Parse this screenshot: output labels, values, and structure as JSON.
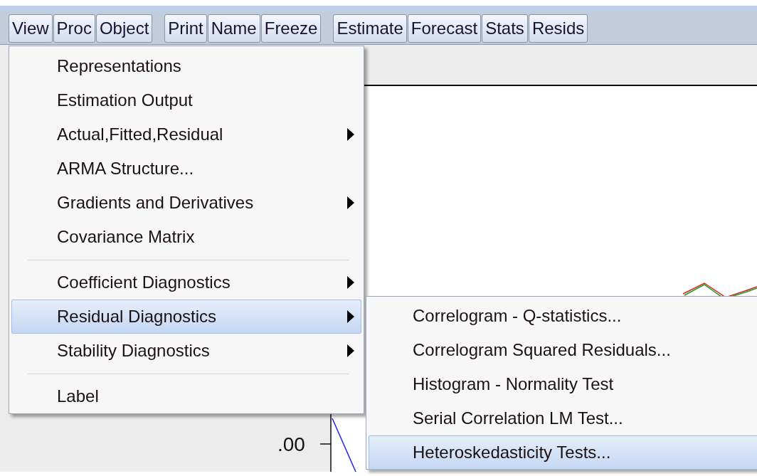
{
  "toolbar": {
    "groups": [
      {
        "buttons": [
          "View",
          "Proc",
          "Object"
        ]
      },
      {
        "buttons": [
          "Print",
          "Name",
          "Freeze"
        ]
      },
      {
        "buttons": [
          "Estimate",
          "Forecast",
          "Stats",
          "Resids"
        ]
      }
    ]
  },
  "chart": {
    "axis_label": ".00"
  },
  "menu": {
    "items": [
      {
        "kind": "item",
        "label": "Representations",
        "submenu": false,
        "selected": false
      },
      {
        "kind": "item",
        "label": "Estimation Output",
        "submenu": false,
        "selected": false
      },
      {
        "kind": "item",
        "label": "Actual,Fitted,Residual",
        "submenu": true,
        "selected": false
      },
      {
        "kind": "item",
        "label": "ARMA Structure...",
        "submenu": false,
        "selected": false
      },
      {
        "kind": "item",
        "label": "Gradients and Derivatives",
        "submenu": true,
        "selected": false
      },
      {
        "kind": "item",
        "label": "Covariance Matrix",
        "submenu": false,
        "selected": false
      },
      {
        "kind": "separator"
      },
      {
        "kind": "item",
        "label": "Coefficient Diagnostics",
        "submenu": true,
        "selected": false
      },
      {
        "kind": "item",
        "label": "Residual Diagnostics",
        "submenu": true,
        "selected": true
      },
      {
        "kind": "item",
        "label": "Stability Diagnostics",
        "submenu": true,
        "selected": false
      },
      {
        "kind": "separator"
      },
      {
        "kind": "item",
        "label": "Label",
        "submenu": false,
        "selected": false
      }
    ]
  },
  "submenu": {
    "items": [
      {
        "label": "Correlogram - Q-statistics...",
        "selected": false
      },
      {
        "label": "Correlogram Squared Residuals...",
        "selected": false
      },
      {
        "label": "Histogram - Normality Test",
        "selected": false
      },
      {
        "label": "Serial Correlation LM Test...",
        "selected": false
      },
      {
        "label": "Heteroskedasticity Tests...",
        "selected": true
      }
    ]
  }
}
